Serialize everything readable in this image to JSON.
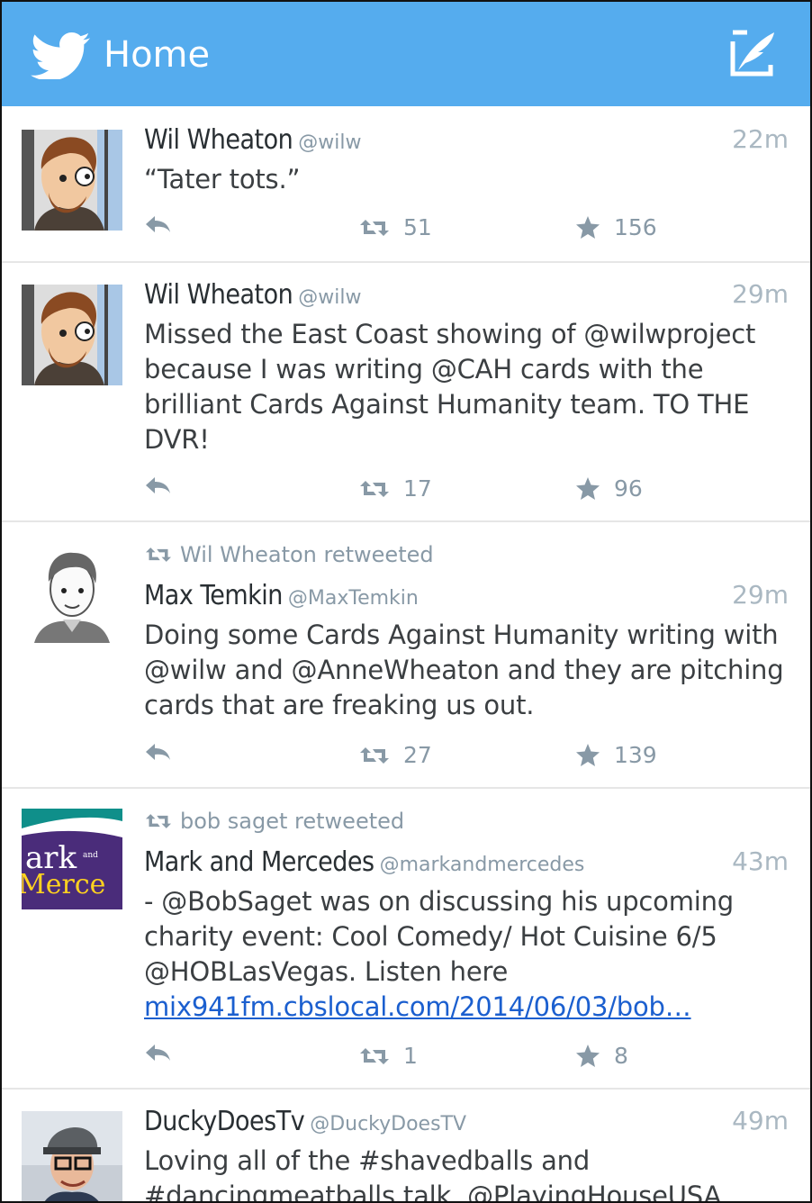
{
  "header": {
    "title": "Home",
    "bird_icon": "twitter-bird-icon",
    "compose_icon": "compose-tweet-icon",
    "background_color": "#55acee"
  },
  "tweets": [
    {
      "name": "Wil Wheaton",
      "handle": "@wilw",
      "time": "22m",
      "text": "“Tater tots.”",
      "retweets": "51",
      "favorites": "156",
      "retweeted_by": ""
    },
    {
      "name": "Wil Wheaton",
      "handle": "@wilw",
      "time": "29m",
      "text": "Missed the East Coast showing of @wilwproject because I was writing @CAH cards with the brilliant Cards Against Humanity team. TO THE DVR!",
      "retweets": "17",
      "favorites": "96",
      "retweeted_by": ""
    },
    {
      "name": "Max Temkin",
      "handle": "@MaxTemkin",
      "time": "29m",
      "text": "Doing some Cards Against Humanity writing with @wilw and @AnneWheaton and they are pitching cards that are freaking us out.",
      "retweets": "27",
      "favorites": "139",
      "retweeted_by": "Wil Wheaton retweeted"
    },
    {
      "name": "Mark and Mercedes",
      "handle": "@markandmercedes",
      "time": "43m",
      "text": "-  @BobSaget was on discussing his upcoming charity event: Cool Comedy/ Hot Cuisine 6/5 @HOBLasVegas. Listen here",
      "link": "mix941fm.cbslocal.com/2014/06/03/bob…",
      "retweets": "1",
      "favorites": "8",
      "retweeted_by": "bob saget retweeted",
      "avatar_text_1": "ark",
      "avatar_text_2": "Merce",
      "avatar_text_3": "and"
    },
    {
      "name": "DuckyDoesTv",
      "handle": "@DuckyDoesTV",
      "time": "49m",
      "text": "Loving all of the #shavedballs and #dancingmeatballs talk. @PlayingHouseUSA",
      "retweets": "",
      "favorites": "",
      "retweeted_by": ""
    }
  ],
  "icons": {
    "reply": "reply-icon",
    "retweet": "retweet-icon",
    "favorite": "star-icon"
  }
}
